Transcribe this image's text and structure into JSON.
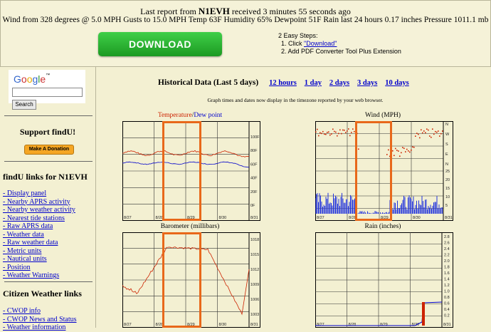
{
  "header": {
    "report_prefix": "Last report from",
    "station": "N1EVH",
    "report_suffix": "received 3 minutes 55 seconds ago",
    "weather_line": "Wind from 328 degrees @ 5.0 MPH Gusts to 15.0 MPH   Temp 63F   Humidity 65%   Dewpoint 51F   Rain last 24 hours 0.17 inches   Pressure 1011.1 mb",
    "download_label": "DOWNLOAD",
    "steps_title": "2 Easy Steps:",
    "step1_prefix": "1. Click ",
    "step1_link": "\"Download\"",
    "step2": "2. Add PDF Converter Tool Plus Extension"
  },
  "sidebar": {
    "google_logo": "Google",
    "search_button": "Search",
    "search_value": "",
    "support_title": "Support findU!",
    "donate_label": "Make A Donation",
    "links_title": "findU links for N1EVH",
    "links": [
      "- Display panel",
      "- Nearby APRS activity",
      "- Nearby weather activity",
      "- Nearest tide stations",
      "- Raw APRS data",
      "- Weather data",
      "- Raw weather data",
      "- Metric units",
      "- Nautical units",
      "- Position",
      "- Weather Warnings"
    ],
    "cw_title": "Citizen Weather links",
    "cw_links": [
      "- CWOP info",
      "- CWOP News and Status",
      "- Weather information"
    ]
  },
  "main": {
    "history_title": "Historical Data (Last 5 days)",
    "ranges": [
      "12 hours",
      "1 day",
      "2 days",
      "3 days",
      "10 days"
    ],
    "note": "Graph times and dates now display in the timezone reported by your web browser."
  },
  "charts": {
    "temp_title_a": "Temperature",
    "temp_title_sep": "/",
    "temp_title_b": "Dew point",
    "wind_title": "Wind (MPH)",
    "baro_title": "Barometer (millibars)",
    "rain_title": "Rain (inches)",
    "dates": [
      "8/27",
      "8/28",
      "8/29",
      "8/30",
      "8/31"
    ],
    "temp_ticks": [
      "100F",
      "80F",
      "60F",
      "40F",
      "20F",
      "0F"
    ],
    "wind_dir_ticks": [
      "N",
      "W",
      "S",
      "E",
      "N"
    ],
    "wind_speed_ticks": [
      "25",
      "20",
      "15",
      "10",
      "5"
    ],
    "baro_ticks": [
      "1018",
      "1015",
      "1012",
      "1009",
      "1006",
      "1003"
    ],
    "rain_ticks": [
      "2.8",
      "2.6",
      "2.4",
      "2.2",
      "2.0",
      "1.8",
      "1.6",
      "1.4",
      "1.2",
      "1.0",
      "0.8",
      "0.6",
      "0.4",
      "0.2"
    ]
  },
  "colors": {
    "temp": "#cc2200",
    "dew": "#0000cc",
    "highlight": "#e8681a",
    "download_bg": "#22a82a"
  },
  "icons": {
    "donate": "donate-button-icon"
  },
  "chart_data": [
    {
      "type": "line",
      "title": "Temperature/Dew point",
      "x": [
        "8/27",
        "8/28",
        "8/29",
        "8/30",
        "8/31"
      ],
      "series": [
        {
          "name": "Temperature",
          "values": [
            75,
            70,
            74,
            72,
            65
          ]
        },
        {
          "name": "Dew point",
          "values": [
            60,
            57,
            60,
            58,
            50
          ]
        }
      ],
      "ylim": [
        0,
        100
      ]
    },
    {
      "type": "scatter",
      "title": "Wind (MPH)",
      "x": [
        "8/27",
        "8/28",
        "8/29",
        "8/30",
        "8/31"
      ],
      "ylim": [
        0,
        25
      ]
    },
    {
      "type": "line",
      "title": "Barometer (millibars)",
      "x": [
        "8/27",
        "8/28",
        "8/29",
        "8/30",
        "8/31"
      ],
      "series": [
        {
          "name": "Barometer",
          "values": [
            1009,
            1016,
            1015,
            1003,
            1011
          ]
        }
      ],
      "ylim": [
        1003,
        1018
      ]
    },
    {
      "type": "line",
      "title": "Rain (inches)",
      "x": [
        "8/27",
        "8/28",
        "8/29",
        "8/30",
        "8/31"
      ],
      "series": [
        {
          "name": "Rain",
          "values": [
            0,
            0,
            0,
            0,
            0.7
          ]
        }
      ],
      "ylim": [
        0,
        2.8
      ]
    }
  ]
}
